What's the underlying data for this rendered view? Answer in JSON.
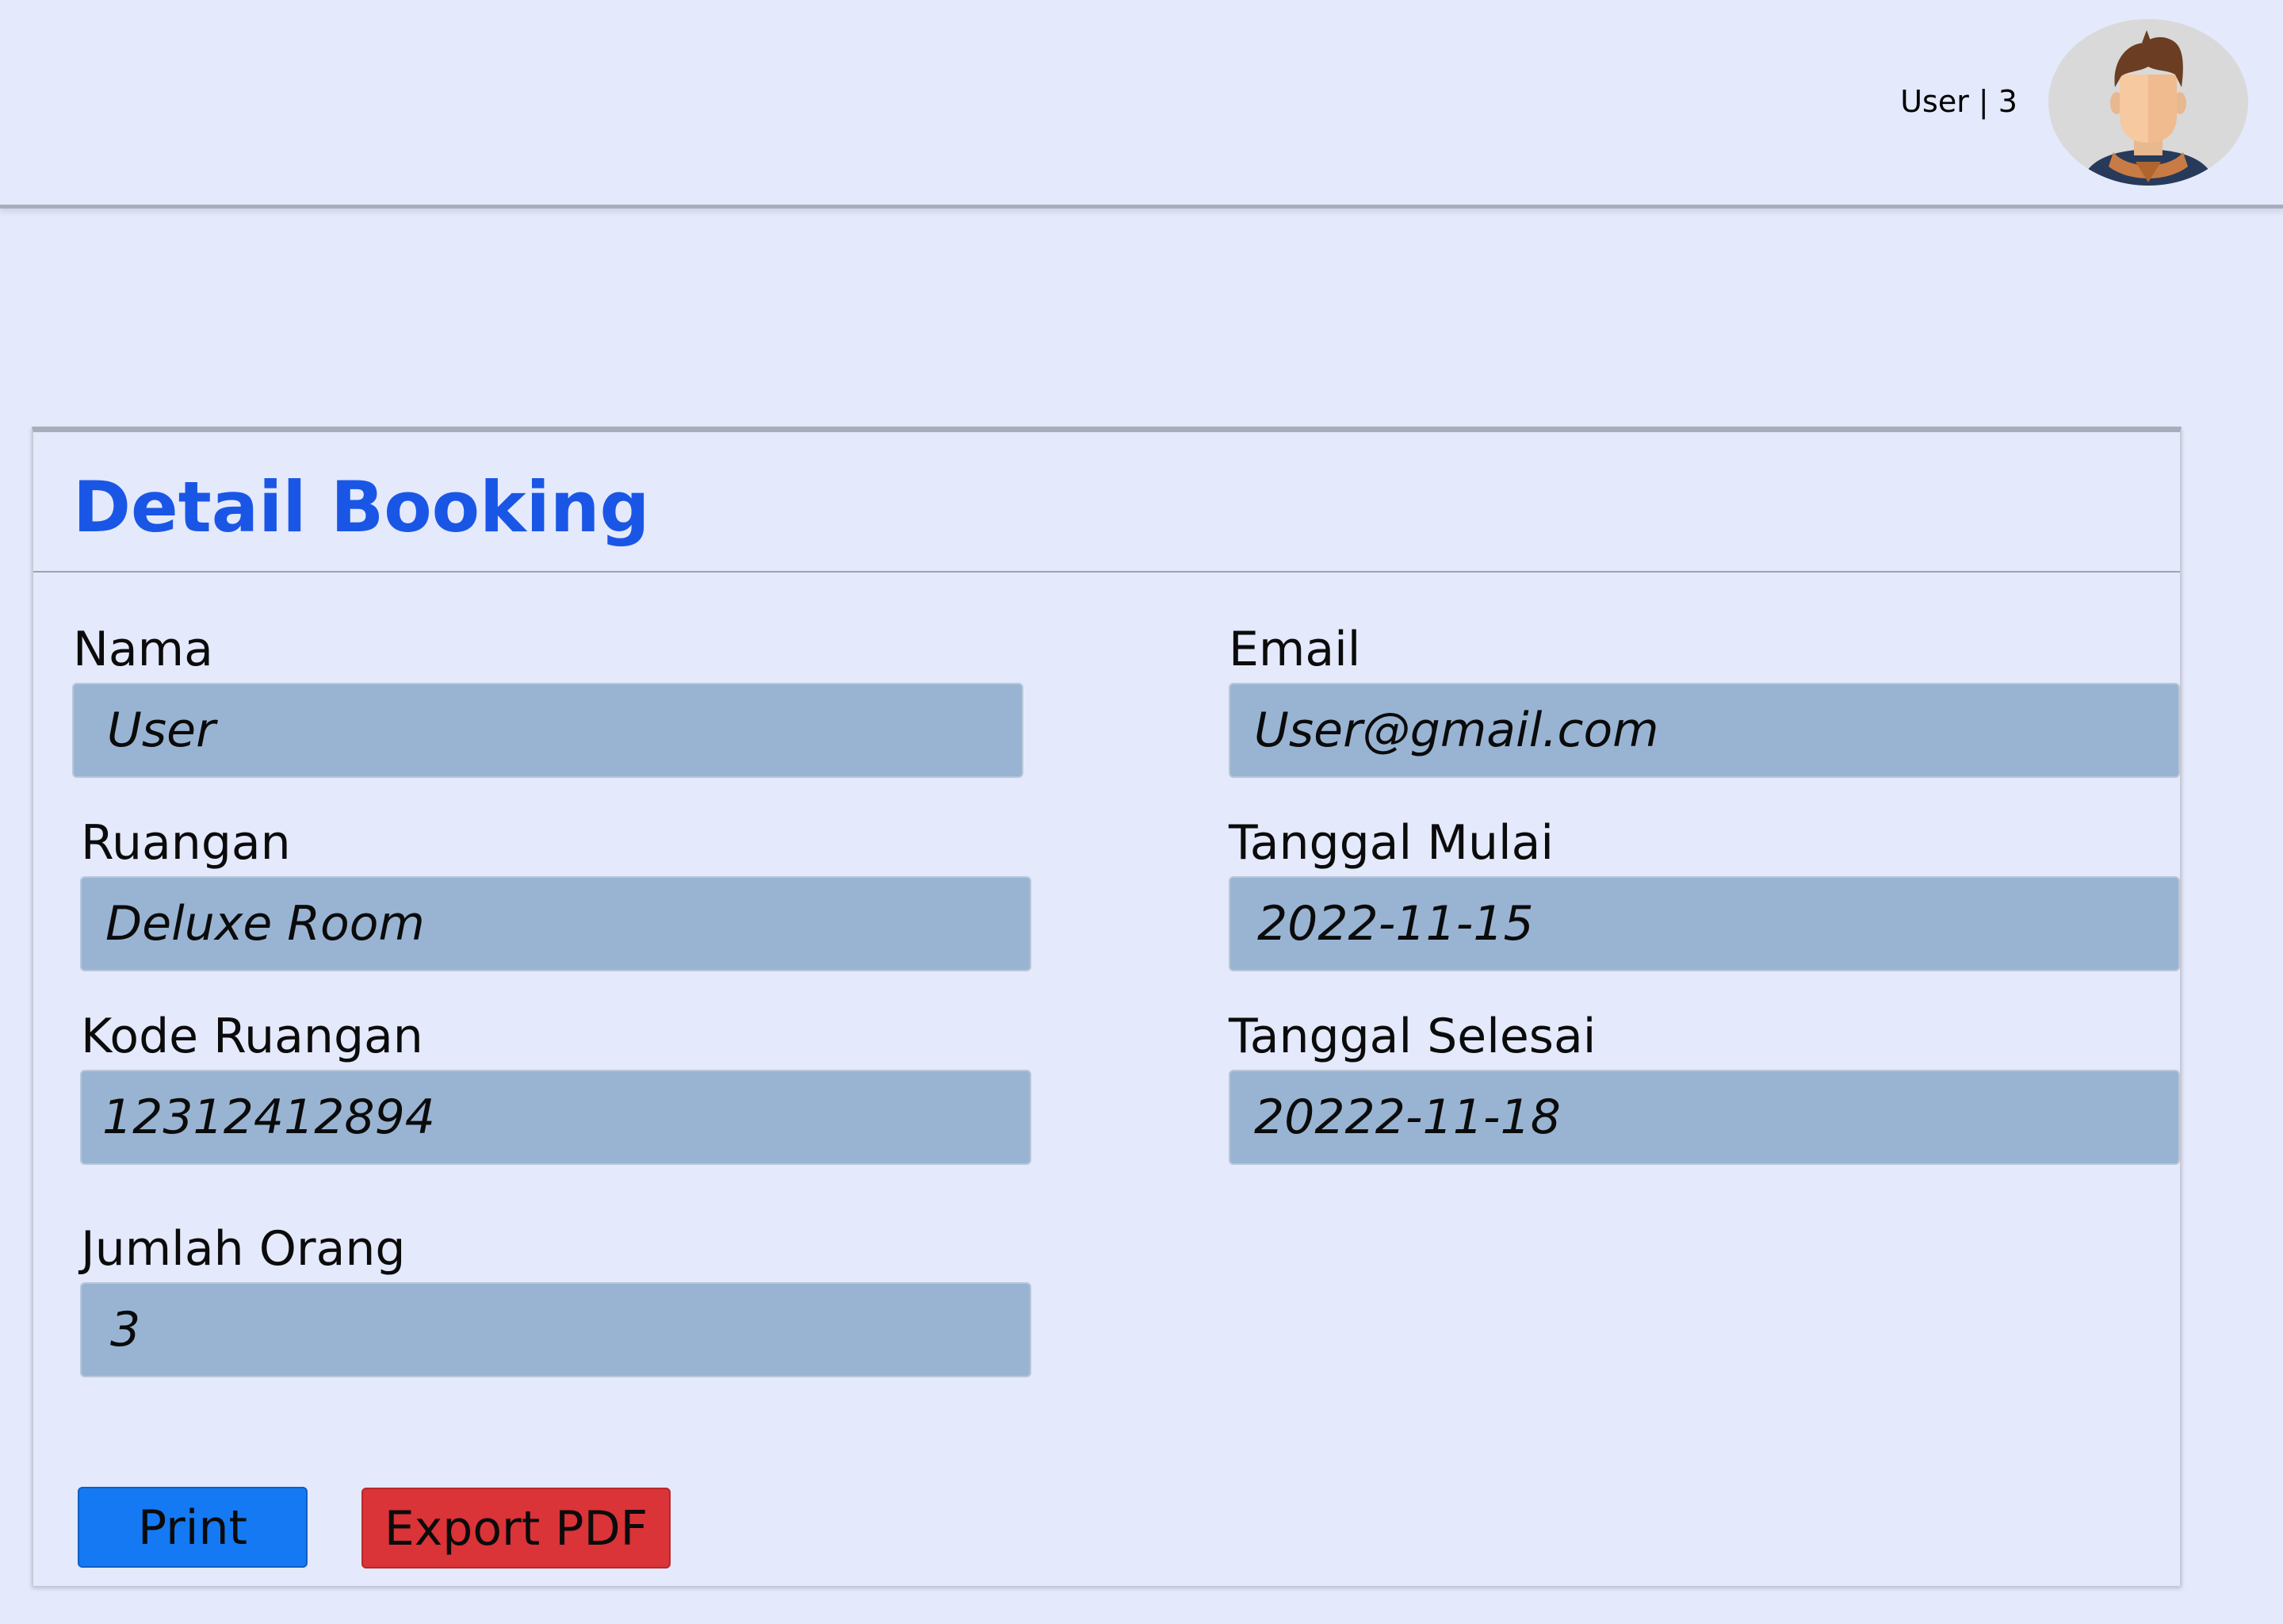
{
  "header": {
    "user_label": "User | 3",
    "avatar_icon": "user-avatar-icon"
  },
  "card": {
    "title": "Detail Booking",
    "fields": {
      "nama": {
        "label": "Nama",
        "value": "User"
      },
      "email": {
        "label": "Email",
        "value": "User@gmail.com"
      },
      "ruangan": {
        "label": "Ruangan",
        "value": "Deluxe Room"
      },
      "tanggal_mulai": {
        "label": "Tanggal Mulai",
        "value": "2022-11-15"
      },
      "kode_ruangan": {
        "label": "Kode Ruangan",
        "value": "12312412894"
      },
      "tanggal_selesai": {
        "label": "Tanggal Selesai",
        "value": "20222-11-18"
      },
      "jumlah_orang": {
        "label": "Jumlah Orang",
        "value": "3"
      }
    },
    "buttons": {
      "print_label": "Print",
      "export_pdf_label": "Export PDF"
    }
  },
  "colors": {
    "background": "#e4e9fb",
    "title": "#1a56e6",
    "field_fill": "#99b4d3",
    "print_button": "#1479f2",
    "export_button": "#da3338"
  }
}
